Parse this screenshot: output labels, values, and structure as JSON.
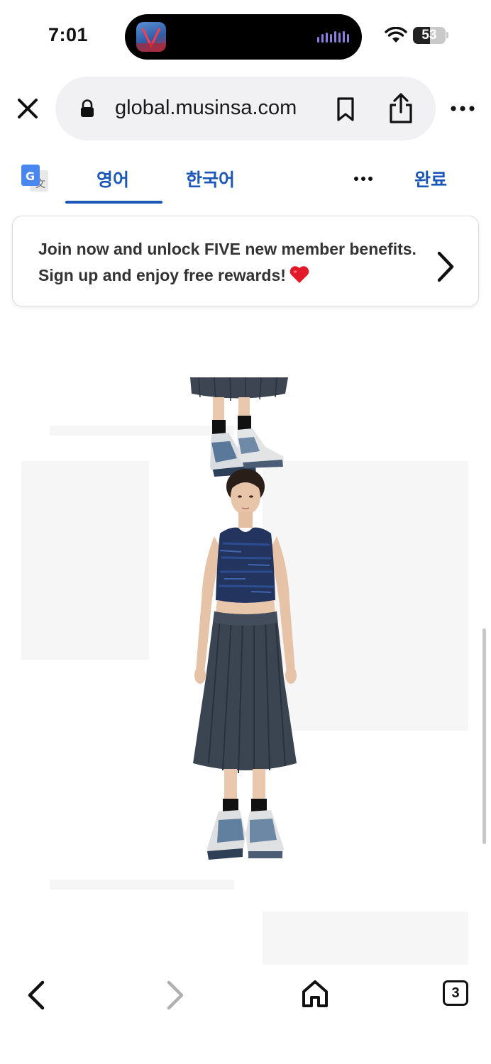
{
  "status_bar": {
    "time": "7:01",
    "battery": "53",
    "battery_level": 0.53,
    "icons": [
      "wifi-icon",
      "battery-icon"
    ]
  },
  "browser": {
    "url": "global.musinsa.com",
    "icons": [
      "close-icon",
      "lock-icon",
      "bookmark-icon",
      "share-icon",
      "more-icon"
    ]
  },
  "translate_bar": {
    "tabs": [
      {
        "label": "영어",
        "active": true
      },
      {
        "label": "한국어",
        "active": false
      }
    ],
    "done_label": "완료",
    "icons": [
      "google-translate-icon",
      "more-icon"
    ],
    "accent_color": "#1a57b8"
  },
  "banner": {
    "text": "Join now and unlock FIVE new member benefits. Sign up and enjoy free rewards!",
    "icons": [
      "heart-icon",
      "chevron-right-icon"
    ]
  },
  "toolbar": {
    "tab_count": "3",
    "icons": [
      "back-icon",
      "forward-icon",
      "home-icon",
      "tabs-icon"
    ]
  }
}
